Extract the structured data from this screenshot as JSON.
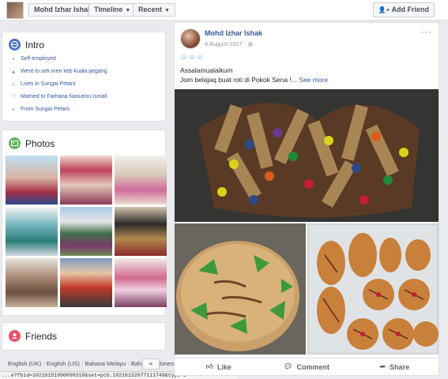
{
  "topbar": {
    "name": "Mohd Izhar Ishak",
    "timeline_label": "Timeline",
    "recent_label": "Recent",
    "add_friend_label": "Add Friend"
  },
  "intro": {
    "title": "Intro",
    "items": [
      {
        "icon": "briefcase-icon",
        "text": "Self-employed"
      },
      {
        "icon": "graduation-cap-icon",
        "text": "Went to sek men keb kuala pegang"
      },
      {
        "icon": "home-icon",
        "text": "Lives in Sungai Petani"
      },
      {
        "icon": "heart-icon",
        "text": "Married to Farhana Nasution Ismail"
      },
      {
        "icon": "location-pin-icon",
        "text": "From Sungai Petani"
      }
    ]
  },
  "photos": {
    "title": "Photos"
  },
  "friends": {
    "title": "Friends"
  },
  "languages": {
    "text": "English (UK) · English (US) · Bahasa Melayu · Bahasa Indonesia"
  },
  "status_url": "...e?fbid=10216151990090318&set=pcb.10216152077111748&type=3",
  "post": {
    "author": "Mohd Izhar Ishak",
    "date": "4 August 2017 ·",
    "emoticons": "☺☺☺",
    "line1": "Assalamualaikum",
    "line2": "Jom belajaq buat roti di Pokok Sena !...",
    "see_more": "See more",
    "more_icon": "···",
    "actions": {
      "like": "Like",
      "comment": "Comment",
      "share": "Share"
    }
  },
  "colors": {
    "link": "#365899",
    "muted": "#90949c",
    "bg": "#e9ebee"
  }
}
